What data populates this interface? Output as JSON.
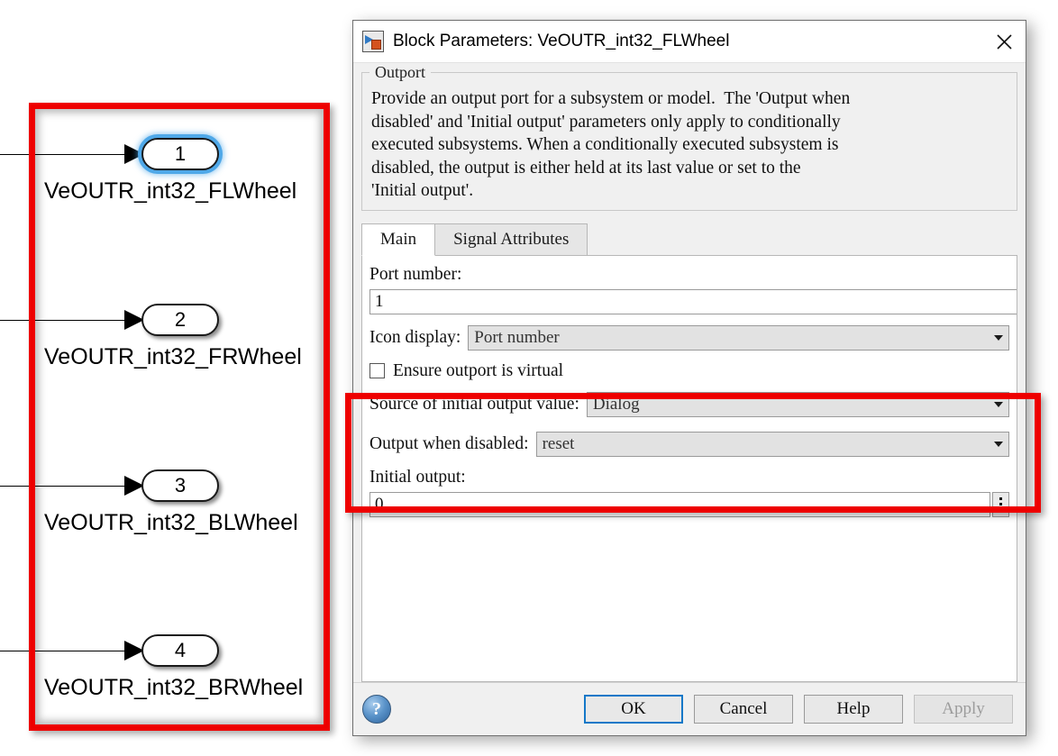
{
  "canvas": {
    "blocks": [
      {
        "port": "1",
        "label": "VeOUTR_int32_FLWheel",
        "selected": true
      },
      {
        "port": "2",
        "label": "VeOUTR_int32_FRWheel",
        "selected": false
      },
      {
        "port": "3",
        "label": "VeOUTR_int32_BLWheel",
        "selected": false
      },
      {
        "port": "4",
        "label": "VeOUTR_int32_BRWheel",
        "selected": false
      }
    ],
    "highlight_color": "#ee0000"
  },
  "dialog": {
    "title": "Block Parameters: VeOUTR_int32_FLWheel",
    "title_icon": "simulink-block-icon",
    "close_icon": "close-icon",
    "description": {
      "legend": "Outport",
      "text": "Provide an output port for a subsystem or model.  The 'Output when\ndisabled' and 'Initial output' parameters only apply to conditionally\nexecuted subsystems. When a conditionally executed subsystem is\ndisabled, the output is either held at its last value or set to the\n'Initial output'."
    },
    "tabs": [
      {
        "label": "Main",
        "active": true
      },
      {
        "label": "Signal Attributes",
        "active": false
      }
    ],
    "fields": {
      "port_number_label": "Port number:",
      "port_number_value": "1",
      "icon_display_label": "Icon display:",
      "icon_display_value": "Port number",
      "ensure_virtual_label": "Ensure outport is virtual",
      "ensure_virtual_checked": false,
      "source_initial_label": "Source of initial output value:",
      "source_initial_value": "Dialog",
      "output_when_disabled_label": "Output when disabled:",
      "output_when_disabled_value": "reset",
      "initial_output_label": "Initial output:",
      "initial_output_value": "0",
      "initial_output_more_icon": "vertical-ellipsis-icon"
    },
    "footer": {
      "help_icon": "help-question-icon",
      "buttons": [
        {
          "label": "OK",
          "state": "default"
        },
        {
          "label": "Cancel",
          "state": "normal"
        },
        {
          "label": "Help",
          "state": "normal"
        },
        {
          "label": "Apply",
          "state": "disabled"
        }
      ]
    },
    "highlight_color": "#ee0000"
  }
}
